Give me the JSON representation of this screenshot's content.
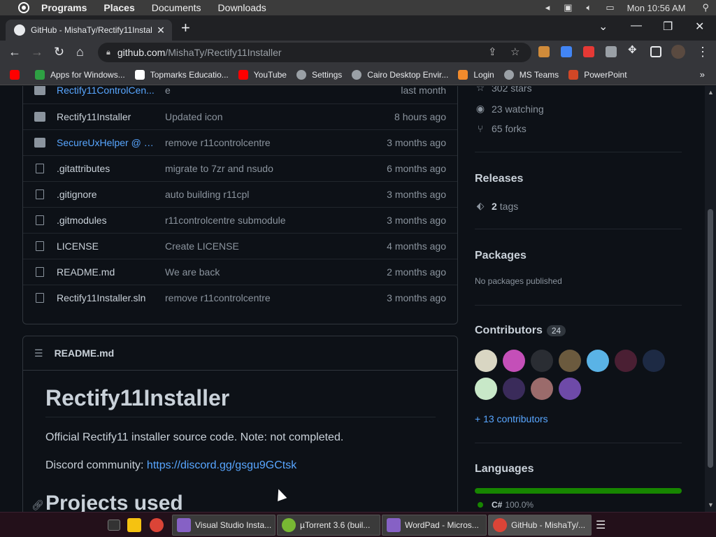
{
  "top_panel": {
    "menu_items": [
      "Programs",
      "Places",
      "Documents",
      "Downloads"
    ],
    "clock": "Mon 10:56 AM"
  },
  "browser": {
    "tab_title": "GitHub - MishaTy/Rectify11Instal",
    "url_host": "github.com",
    "url_path": "/MishaTy/Rectify11Installer",
    "bookmarks": [
      {
        "label": "",
        "icon": "youtube-icon",
        "color": "#ff0000"
      },
      {
        "label": "Apps for Windows...",
        "icon": "apps-icon",
        "color": "#2ea043"
      },
      {
        "label": "Topmarks Educatio...",
        "icon": "checkmark-icon",
        "color": "#ffffff"
      },
      {
        "label": "YouTube",
        "icon": "youtube-icon",
        "color": "#ff0000"
      },
      {
        "label": "Settings",
        "icon": "gear-icon",
        "color": "#9aa0a6"
      },
      {
        "label": "Cairo Desktop Envir...",
        "icon": "cairo-icon",
        "color": "#9aa0a6"
      },
      {
        "label": "Login",
        "icon": "edge-icon",
        "color": "#f28b2c"
      },
      {
        "label": "MS Teams",
        "icon": "globe-icon",
        "color": "#9aa0a6"
      },
      {
        "label": "PowerPoint",
        "icon": "powerpoint-icon",
        "color": "#d24726"
      }
    ]
  },
  "files": [
    {
      "name": "Rectify11ControlCen...",
      "message": "e",
      "age": "last month",
      "type": "submodule",
      "link": true
    },
    {
      "name": "Rectify11Installer",
      "message": "Updated icon",
      "age": "8 hours ago",
      "type": "dir",
      "link": false
    },
    {
      "name": "SecureUxHelper @ 7...",
      "message": "remove r11controlcentre",
      "age": "3 months ago",
      "type": "submodule",
      "link": true
    },
    {
      "name": ".gitattributes",
      "message": "migrate to 7zr and nsudo",
      "age": "6 months ago",
      "type": "file",
      "link": false
    },
    {
      "name": ".gitignore",
      "message": "auto building r11cpl",
      "age": "3 months ago",
      "type": "file",
      "link": false
    },
    {
      "name": ".gitmodules",
      "message": "r11controlcentre submodule",
      "age": "3 months ago",
      "type": "file",
      "link": false
    },
    {
      "name": "LICENSE",
      "message": "Create LICENSE",
      "age": "4 months ago",
      "type": "file",
      "link": false
    },
    {
      "name": "README.md",
      "message": "We are back",
      "age": "2 months ago",
      "type": "file",
      "link": false
    },
    {
      "name": "Rectify11Installer.sln",
      "message": "remove r11controlcentre",
      "age": "3 months ago",
      "type": "file",
      "link": false
    }
  ],
  "readme": {
    "header": "README.md",
    "title": "Rectify11Installer",
    "description": "Official Rectify11 installer source code. Note: not completed.",
    "discord_label": "Discord community: ",
    "discord_link": "https://discord.gg/gsgu9GCtsk",
    "section2": "Projects used"
  },
  "sidebar": {
    "stars": "302 stars",
    "watching": "23 watching",
    "forks": "65 forks",
    "releases_heading": "Releases",
    "tags_count": "2",
    "tags_label": "tags",
    "packages_heading": "Packages",
    "packages_text": "No packages published",
    "contributors_heading": "Contributors",
    "contributors_count": "24",
    "more_contributors": "+ 13 contributors",
    "avatar_colors": [
      "#d9d6c3",
      "#c44fb8",
      "#2a2d33",
      "#6b5a3e",
      "#5ab3e6",
      "#4a1f33",
      "#1d2a44",
      "#c8e8c8",
      "#3a2b5a",
      "#9b6b6b",
      "#6e4aa8"
    ],
    "languages_heading": "Languages",
    "language_name": "C#",
    "language_percent": "100.0%",
    "language_color": "#178600"
  },
  "taskbar": {
    "items": [
      {
        "label": "Visual Studio Insta...",
        "icon": "visual-studio-icon",
        "color": "#8661c5"
      },
      {
        "label": "µTorrent 3.6  (buil...",
        "icon": "utorrent-icon",
        "color": "#78b833"
      },
      {
        "label": "WordPad - Micros...",
        "icon": "wordpad-icon",
        "color": "#8661c5"
      },
      {
        "label": "GitHub - MishaTy/...",
        "icon": "chrome-icon",
        "color": "#e8e8e8"
      }
    ]
  }
}
